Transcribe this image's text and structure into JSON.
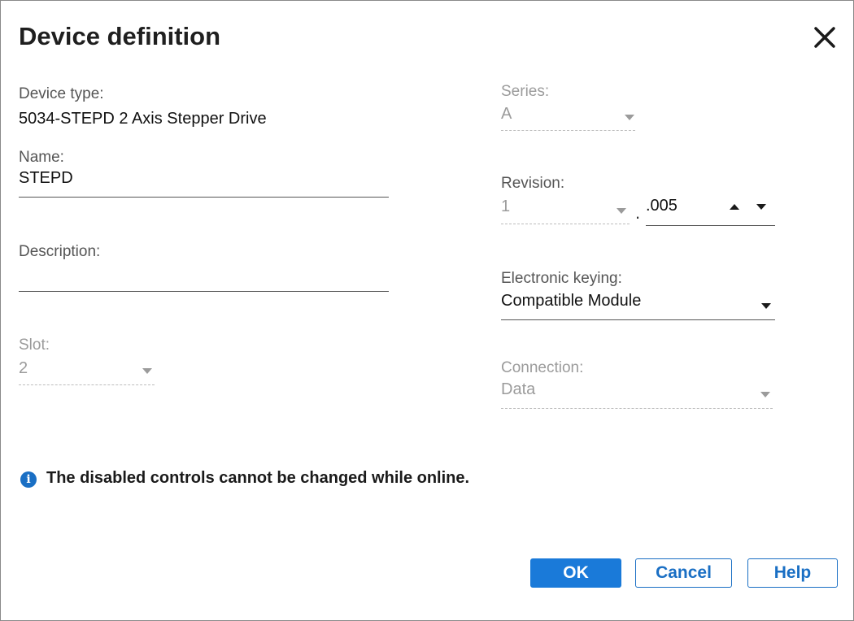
{
  "dialog": {
    "title": "Device definition",
    "close_icon": "close-icon"
  },
  "form": {
    "device_type": {
      "label": "Device type:",
      "value": "5034-STEPD 2 Axis Stepper Drive"
    },
    "name": {
      "label": "Name:",
      "value": "STEPD"
    },
    "description": {
      "label": "Description:",
      "value": ""
    },
    "slot": {
      "label": "Slot:",
      "value": "2",
      "disabled": true
    },
    "series": {
      "label": "Series:",
      "value": "A",
      "disabled": true
    },
    "revision": {
      "label": "Revision:",
      "major": "1",
      "separator": ".",
      "minor": ".005"
    },
    "electronic_keying": {
      "label": "Electronic keying:",
      "value": "Compatible Module"
    },
    "connection": {
      "label": "Connection:",
      "value": "Data",
      "disabled": true
    }
  },
  "info": {
    "icon": "info-icon",
    "symbol": "i",
    "message": "The disabled controls cannot be changed while online."
  },
  "buttons": {
    "ok": "OK",
    "cancel": "Cancel",
    "help": "Help"
  },
  "colors": {
    "accent": "#1a7ad9",
    "disabled_text": "#9b9b9b",
    "info_icon": "#1a6fc4"
  }
}
